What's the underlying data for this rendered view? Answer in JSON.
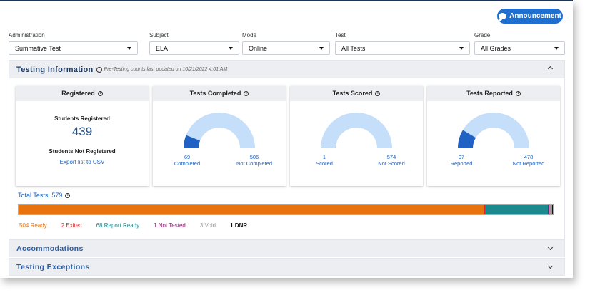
{
  "announcement_label": "Announcement",
  "filters": [
    {
      "label": "Administration",
      "value": "Summative Test"
    },
    {
      "label": "Subject",
      "value": "ELA"
    },
    {
      "label": "Mode",
      "value": "Online"
    },
    {
      "label": "Test",
      "value": "All Tests"
    },
    {
      "label": "Grade",
      "value": "All Grades"
    }
  ],
  "testing_info": {
    "title": "Testing Information",
    "note": "Pre-Testing counts last updated on 10/21/2022 4:01 AM",
    "registered": {
      "title": "Registered",
      "students_registered_label": "Students Registered",
      "students_registered": "439",
      "not_registered_label": "Students Not Registered",
      "export_label": "Export list to CSV"
    },
    "gauges": [
      {
        "title": "Tests Completed",
        "left_value": "69",
        "left_label": "Completed",
        "right_value": "506",
        "right_label": "Not Completed",
        "fraction": 0.12
      },
      {
        "title": "Tests Scored",
        "left_value": "1",
        "left_label": "Scored",
        "right_value": "574",
        "right_label": "Not Scored",
        "fraction": 0.002
      },
      {
        "title": "Tests Reported",
        "left_value": "97",
        "left_label": "Reported",
        "right_value": "478",
        "right_label": "Not Reported",
        "fraction": 0.17
      }
    ],
    "total_tests_label": "Total Tests: 579",
    "status_segments": [
      {
        "label": "504 Ready",
        "count": 504,
        "color": "#e8720c"
      },
      {
        "label": "2 Exited",
        "count": 2,
        "color": "#d62828"
      },
      {
        "label": "68 Report Ready",
        "count": 68,
        "color": "#1a8a8f"
      },
      {
        "label": "1 Not Tested",
        "count": 1,
        "color": "#8e1b74"
      },
      {
        "label": "3 Void",
        "count": 3,
        "color": "#999999"
      },
      {
        "label": "1 DNR",
        "count": 1,
        "color": "#111111"
      }
    ]
  },
  "sections": [
    {
      "title": "Accommodations"
    },
    {
      "title": "Testing Exceptions"
    }
  ],
  "colors": {
    "gauge_fill": "#1f62c4",
    "gauge_track": "#c5def9",
    "accent": "#1f6fd1"
  }
}
